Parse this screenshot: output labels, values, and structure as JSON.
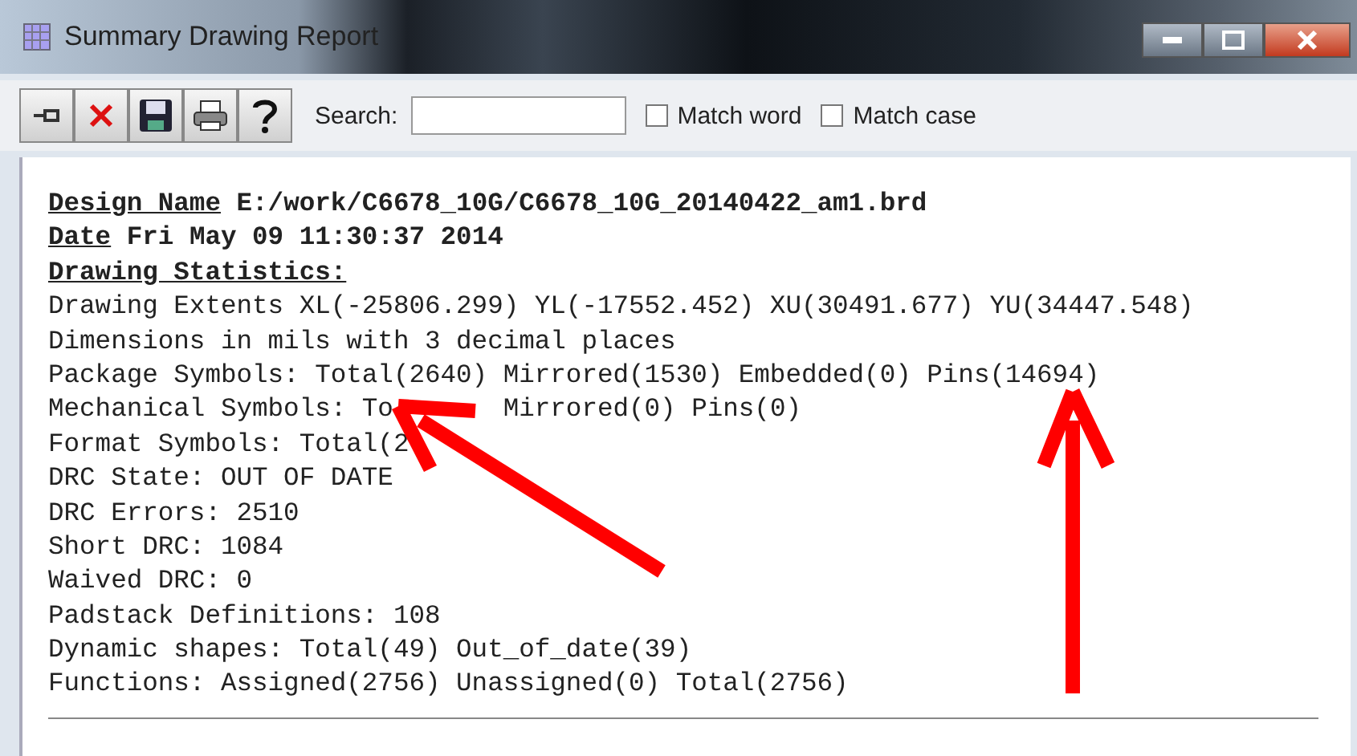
{
  "window": {
    "title": "Summary Drawing Report"
  },
  "toolbar": {
    "buttons": [
      {
        "kind": "pin"
      },
      {
        "kind": "delete"
      },
      {
        "kind": "save"
      },
      {
        "kind": "print"
      },
      {
        "kind": "help"
      }
    ],
    "search_label": "Search:",
    "options": [
      {
        "label": "Match word",
        "checked": false
      },
      {
        "label": "Match case",
        "checked": false
      }
    ]
  },
  "report": {
    "lines": [
      {
        "kind": "field",
        "label": "Design Name",
        "value": "E:/work/C6678_10G/C6678_10G_20140422_am1.brd"
      },
      {
        "kind": "field",
        "label": "Date",
        "value": "Fri May 09 11:30:37 2014"
      },
      {
        "kind": "heading",
        "text": "Drawing Statistics:"
      },
      {
        "kind": "plain",
        "parts": [
          "Drawing Extents XL(-25806.299) YL(-17552.452) XU(30491.677) YU(34447.548)"
        ]
      },
      {
        "kind": "plain",
        "parts": [
          "Dimensions in mils with 3 decimal places"
        ]
      },
      {
        "kind": "plain",
        "parts": [
          "Package Symbols: Total(2640) Mirrored(1530) Embedded(0) Pins(14694)"
        ]
      },
      {
        "kind": "plain",
        "parts": [
          "Mechanical Symbols: To",
          "Mirrored(0) Pins(0)"
        ]
      },
      {
        "kind": "plain",
        "parts": [
          "Format Symbols: Total(2"
        ]
      },
      {
        "kind": "plain",
        "parts": [
          "DRC State: OUT OF DATE"
        ]
      },
      {
        "kind": "plain",
        "parts": [
          "DRC Errors: 2510"
        ]
      },
      {
        "kind": "plain",
        "parts": [
          "Short DRC: 1084"
        ]
      },
      {
        "kind": "plain",
        "parts": [
          "Waived DRC: 0"
        ]
      },
      {
        "kind": "plain",
        "parts": [
          "Padstack Definitions: 108"
        ]
      },
      {
        "kind": "plain",
        "parts": [
          "Dynamic shapes: Total(49) Out_of_date(39)"
        ]
      },
      {
        "kind": "plain",
        "parts": [
          "Functions: Assigned(2756) Unassigned(0) Total(2756)"
        ]
      },
      {
        "kind": "rule"
      }
    ]
  }
}
